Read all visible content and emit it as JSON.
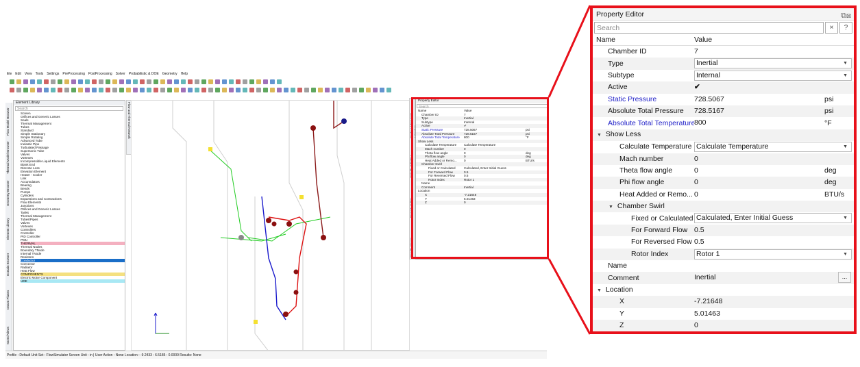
{
  "app": {
    "menu": [
      "Ele",
      "Edit",
      "View",
      "Tools",
      "Settings",
      "PreProcessing",
      "PostProcessing",
      "Solver",
      "Probabilistic & DOE",
      "Geometry",
      "Help"
    ],
    "left_tabs": [
      "Flow Model Browser",
      "Thermal Model Browser",
      "Geometry Browser",
      "Element Library",
      "Domain Browser",
      "Datum Planes",
      "Saved Views"
    ],
    "element_library": {
      "title": "Element Library",
      "search_placeholder": "Search",
      "tree": [
        "Screen",
        "Orifices and Generic Losses",
        "Seals",
        "Thermal Management",
        "Tubes",
        "Standard",
        "Simple Stationary",
        "Simple Rotating",
        "Advanced Tube",
        "Inelastic Pipe",
        "Turbulated Passage",
        "Supersonic Tube",
        "Valves",
        "Vortexes",
        "Incompressible Liquid Elements",
        "Blank End",
        "Discrete Loss",
        "Elevation Element",
        "Heater - Cooler",
        "Link",
        "Accumulators",
        "Bearing",
        "Bends",
        "Pumps",
        "Cylinders",
        "Expansions and Contractions",
        "Flow Elements",
        "Junctions",
        "Orifices and Generic Losses",
        "Tanks",
        "Thermal Management",
        "Tubes/Pipes",
        "Valves",
        "Vortexes",
        "Controllers",
        "Controller",
        "PID Controller",
        "PMU",
        "THERMAL",
        "Thermal Nodes",
        "Boundary TNode",
        "Internal TNode",
        "Resistors",
        "Conductor",
        "Convector",
        "Radiator",
        "Heat Flow",
        "COMPONENTS",
        "Electric Motor Component",
        "UDE"
      ]
    },
    "canvas_tab": "Flow and Thermal Network",
    "mini_tabs": [
      "Contour / Transient Animation",
      "Variable Edit Tree",
      "Property Editor",
      "Results Viewer"
    ],
    "status": "Profile : Default   Unit Set : FlowSimulator   Screen Unit : in   |   User Action : None   Location : -9.2433 : 6.5185 : 0.0000   Results: None"
  },
  "property_editor": {
    "title": "Property Editor",
    "search_placeholder": "Search",
    "search_clear": "×",
    "help": "?",
    "col_name": "Name",
    "col_value": "Value",
    "rows": [
      {
        "name": "Chamber ID",
        "value": "7",
        "unit": "",
        "indent": 1,
        "type": "text"
      },
      {
        "name": "Type",
        "value": "Inertial",
        "unit": "",
        "indent": 1,
        "type": "dropdown"
      },
      {
        "name": "Subtype",
        "value": "Internal",
        "unit": "",
        "indent": 1,
        "type": "dropdown"
      },
      {
        "name": "Active",
        "value": "✔",
        "unit": "",
        "indent": 1,
        "type": "check"
      },
      {
        "name": "Static Pressure",
        "value": "728.5067",
        "unit": "psi",
        "indent": 1,
        "type": "text",
        "blue": true
      },
      {
        "name": "Absolute Total Pressure",
        "value": "728.5167",
        "unit": "psi",
        "indent": 1,
        "type": "text"
      },
      {
        "name": "Absolute Total Temperature",
        "value": "800",
        "unit": "°F",
        "indent": 1,
        "type": "text",
        "blue": true
      },
      {
        "name": "Show Less",
        "value": "",
        "unit": "",
        "indent": 0,
        "type": "group"
      },
      {
        "name": "Calculate Temperature",
        "value": "Calculate Temperature",
        "unit": "",
        "indent": 2,
        "type": "dropdown"
      },
      {
        "name": "Mach number",
        "value": "0",
        "unit": "",
        "indent": 2,
        "type": "text"
      },
      {
        "name": "Theta flow angle",
        "value": "0",
        "unit": "deg",
        "indent": 2,
        "type": "text"
      },
      {
        "name": "Phi flow angle",
        "value": "0",
        "unit": "deg",
        "indent": 2,
        "type": "text"
      },
      {
        "name": "Heat Added or Remo...",
        "value": "0",
        "unit": "BTU/s",
        "indent": 2,
        "type": "text"
      },
      {
        "name": "Chamber Swirl",
        "value": "",
        "unit": "",
        "indent": 1,
        "type": "group"
      },
      {
        "name": "Fixed or Calculated",
        "value": "Calculated, Enter Initial Guess",
        "unit": "",
        "indent": 3,
        "type": "dropdown"
      },
      {
        "name": "For Forward Flow",
        "value": "0.5",
        "unit": "",
        "indent": 3,
        "type": "text"
      },
      {
        "name": "For Reversed Flow",
        "value": "0.5",
        "unit": "",
        "indent": 3,
        "type": "text"
      },
      {
        "name": "Rotor Index",
        "value": "Rotor 1",
        "unit": "",
        "indent": 3,
        "type": "dropdown"
      },
      {
        "name": "Name",
        "value": "",
        "unit": "",
        "indent": 1,
        "type": "text"
      },
      {
        "name": "Comment",
        "value": "Inertial",
        "unit": "",
        "indent": 1,
        "type": "ellipsis"
      },
      {
        "name": "Location",
        "value": "",
        "unit": "",
        "indent": 0,
        "type": "group"
      },
      {
        "name": "X",
        "value": "-7.21648",
        "unit": "",
        "indent": 2,
        "type": "text"
      },
      {
        "name": "Y",
        "value": "5.01463",
        "unit": "",
        "indent": 2,
        "type": "text"
      },
      {
        "name": "Z",
        "value": "0",
        "unit": "",
        "indent": 2,
        "type": "text"
      }
    ]
  },
  "colors": {
    "highlight_red": "#e8101a",
    "blue_label": "#2020c8"
  }
}
